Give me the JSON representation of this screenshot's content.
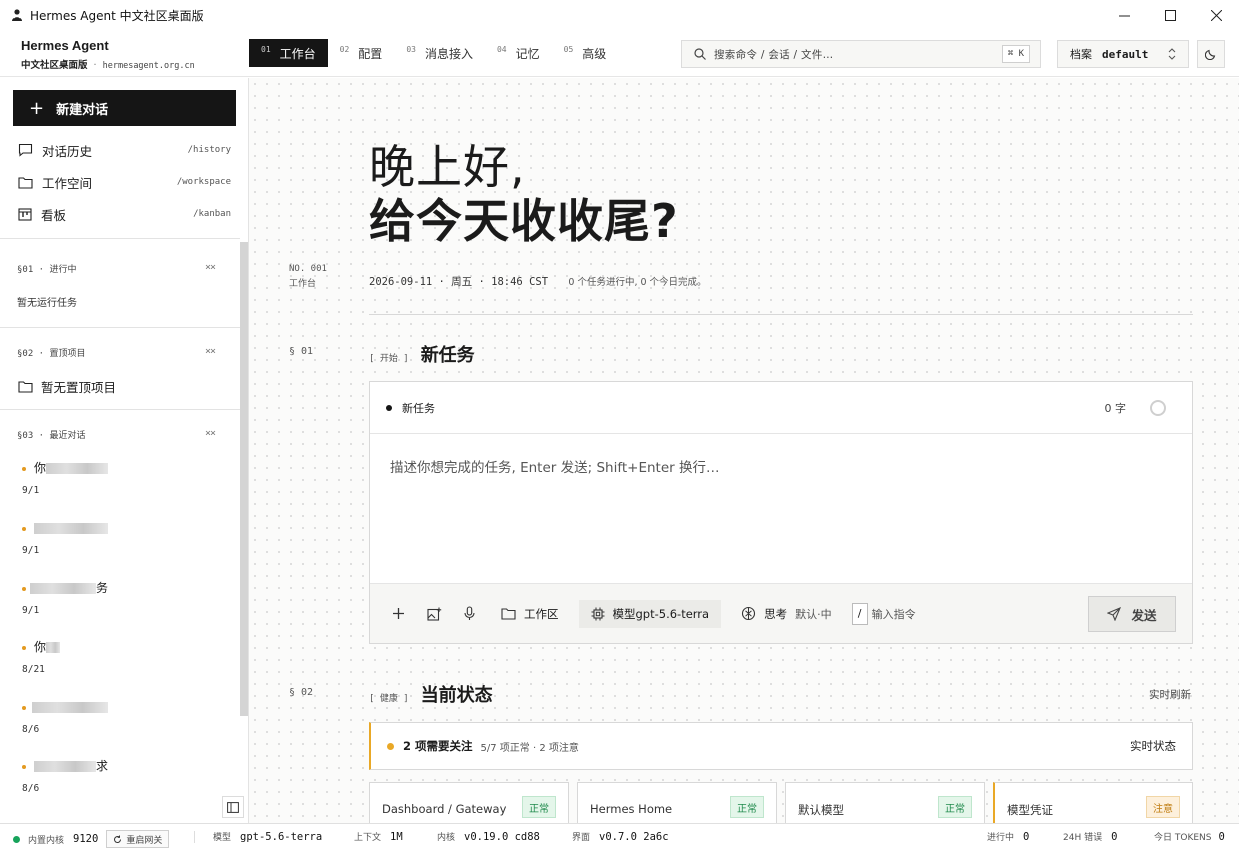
{
  "window": {
    "title": "Hermes Agent 中文社区桌面版"
  },
  "brand": {
    "name": "Hermes Agent",
    "subtitle": "中文社区桌面版",
    "sep": "·",
    "domain": "hermesagent.org.cn"
  },
  "nav": {
    "tabs": [
      {
        "num": "01",
        "label": "工作台"
      },
      {
        "num": "02",
        "label": "配置"
      },
      {
        "num": "03",
        "label": "消息接入"
      },
      {
        "num": "04",
        "label": "记忆"
      },
      {
        "num": "05",
        "label": "高级"
      }
    ]
  },
  "search": {
    "placeholder": "搜索命令 / 会话 / 文件…",
    "shortcut": "⌘ K"
  },
  "profile": {
    "label": "档案",
    "value": "default"
  },
  "sidebar": {
    "new_chat": "新建对话",
    "links": [
      {
        "label": "对话历史",
        "path": "/history"
      },
      {
        "label": "工作空间",
        "path": "/workspace"
      },
      {
        "label": "看板",
        "path": "/kanban"
      }
    ],
    "running": {
      "head": "§01 · 进行中",
      "clear": "××",
      "empty": "暂无运行任务"
    },
    "pinned": {
      "head": "§02 · 置顶项目",
      "clear": "××",
      "empty": "暂无置顶项目"
    },
    "recent": {
      "head": "§03 · 最近对话",
      "clear": "××",
      "items": [
        {
          "title": "你",
          "date": "9/1"
        },
        {
          "title": "",
          "date": "9/1"
        },
        {
          "title": "务",
          "date": "9/1"
        },
        {
          "title": "你",
          "date": "8/21"
        },
        {
          "title": "",
          "date": "8/6"
        },
        {
          "title": "求",
          "date": "8/6"
        }
      ]
    }
  },
  "main": {
    "greeting_line1": "晚上好,",
    "greeting_line2": "给今天收收尾?",
    "no_label": "NO. 001",
    "no_sub": "工作台",
    "datetime": "2026-09-11 · 周五 · 18:46 CST",
    "task_status": "0 个任务进行中, 0 个今日完成。",
    "section1": {
      "num": "§ 01",
      "tag": "[ 开始 ]",
      "title": "新任务"
    },
    "task": {
      "label": "新任务",
      "count": "0 字",
      "placeholder": "描述你想完成的任务, Enter 发送; Shift+Enter 换行…",
      "workspace": "工作区",
      "model_label": "模型",
      "model_value": "gpt-5.6-terra",
      "think_label": "思考",
      "think_value": "默认·中",
      "cmd_key": "/",
      "cmd_label": "输入指令",
      "send": "发送"
    },
    "section2": {
      "num": "§ 02",
      "tag": "[ 健康 ]",
      "title": "当前状态",
      "refresh": "实时刷新"
    },
    "alert": {
      "title": "2 项需要关注",
      "detail": "5/7 项正常 · 2 项注意",
      "right": "实时状态"
    },
    "cards": [
      {
        "name": "Dashboard / Gateway",
        "badge": "正常",
        "state": "ok"
      },
      {
        "name": "Hermes Home",
        "badge": "正常",
        "state": "ok"
      },
      {
        "name": "默认模型",
        "badge": "正常",
        "state": "ok"
      },
      {
        "name": "模型凭证",
        "badge": "注意",
        "state": "warn"
      }
    ]
  },
  "statusbar": {
    "gateway_label": "内置内核",
    "gateway_value": "9120",
    "restart": "重启网关",
    "model_label": "模型",
    "model_value": "gpt-5.6-terra",
    "context_label": "上下文",
    "context_value": "1M",
    "kernel_label": "内核",
    "kernel_value": "v0.19.0 cd88",
    "ui_label": "界面",
    "ui_value": "v0.7.0 2a6c",
    "running_label": "进行中",
    "running_value": "0",
    "errors_label": "24H 错误",
    "errors_value": "0",
    "tokens_label": "今日 TOKENS",
    "tokens_value": "0"
  },
  "colors": {
    "accent": "#151515",
    "warning": "#e9a826",
    "ok": "#1f8a4c",
    "status_dot": "#17a35b"
  }
}
